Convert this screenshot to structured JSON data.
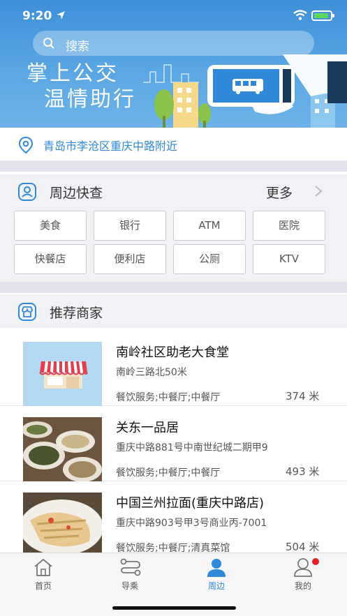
{
  "status": {
    "time": "9:20"
  },
  "search": {
    "placeholder": "搜索"
  },
  "banner": {
    "line1": "掌上公交",
    "line2": "温情助行"
  },
  "location": {
    "text": "青岛市李沧区重庆中路附近"
  },
  "nearby": {
    "title": "周边快查",
    "more": "更多",
    "categories": [
      "美食",
      "银行",
      "ATM",
      "医院",
      "快餐店",
      "便利店",
      "公厕",
      "KTV"
    ]
  },
  "recommend": {
    "title": "推荐商家",
    "items": [
      {
        "name": "南岭社区助老大食堂",
        "address": "南岭三路北50米",
        "category": "餐饮服务;中餐厅;中餐厅",
        "distance": "374 米"
      },
      {
        "name": "关东一品居",
        "address": "重庆中路881号中南世纪城二期甲9",
        "category": "餐饮服务;中餐厅;中餐厅",
        "distance": "493 米"
      },
      {
        "name": "中国兰州拉面(重庆中路店)",
        "address": "重庆中路903号甲3号商业丙-7001",
        "category": "餐饮服务;中餐厅;清真菜馆",
        "distance": "504 米"
      }
    ]
  },
  "tabs": [
    "首页",
    "导乘",
    "周边",
    "我的"
  ],
  "colors": {
    "accent": "#2f88d8",
    "banner": "#3d8fd8",
    "badge": "#e8202a"
  }
}
